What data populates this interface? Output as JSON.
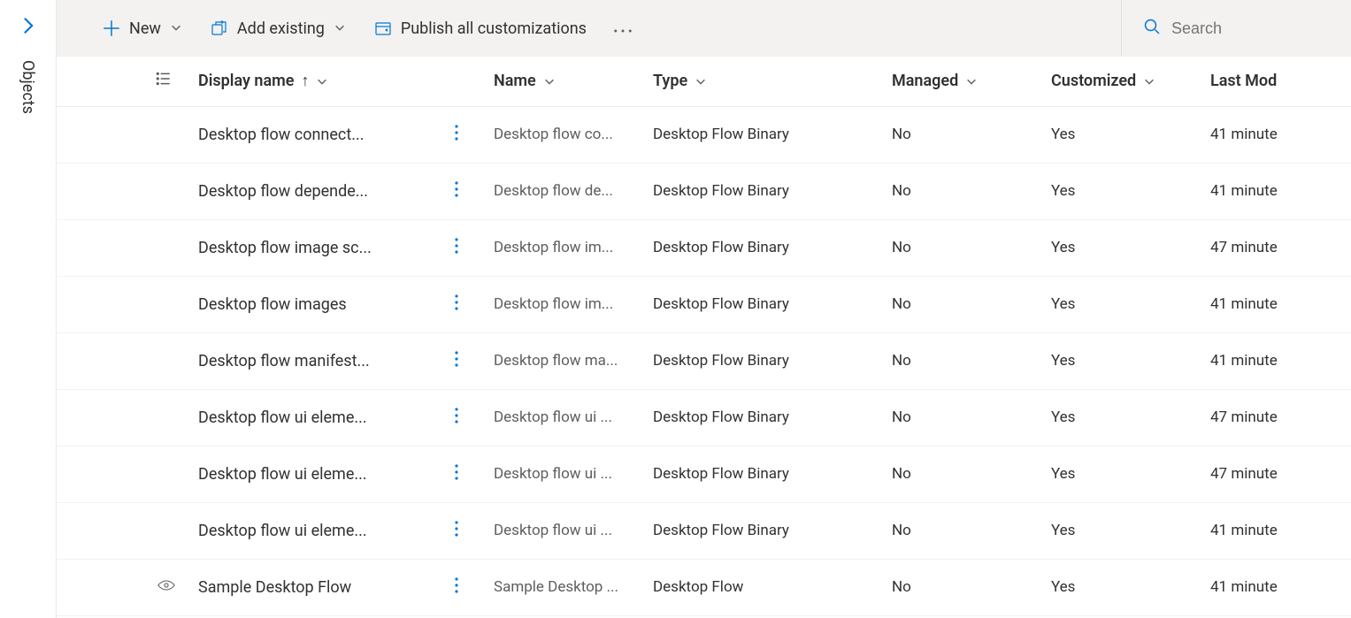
{
  "side": {
    "label": "Objects"
  },
  "commands": {
    "new": "New",
    "add_existing": "Add existing",
    "publish": "Publish all customizations"
  },
  "search": {
    "placeholder": "Search"
  },
  "columns": {
    "display_name": "Display name",
    "name": "Name",
    "type": "Type",
    "managed": "Managed",
    "customized": "Customized",
    "last_modified": "Last Mod"
  },
  "rows": [
    {
      "display": "Desktop flow connect...",
      "name": "Desktop flow co...",
      "type": "Desktop Flow Binary",
      "managed": "No",
      "customized": "Yes",
      "modified": "41 minute",
      "visible_icon": false
    },
    {
      "display": "Desktop flow depende...",
      "name": "Desktop flow de...",
      "type": "Desktop Flow Binary",
      "managed": "No",
      "customized": "Yes",
      "modified": "41 minute",
      "visible_icon": false
    },
    {
      "display": "Desktop flow image sc...",
      "name": "Desktop flow im...",
      "type": "Desktop Flow Binary",
      "managed": "No",
      "customized": "Yes",
      "modified": "47 minute",
      "visible_icon": false
    },
    {
      "display": "Desktop flow images",
      "name": "Desktop flow im...",
      "type": "Desktop Flow Binary",
      "managed": "No",
      "customized": "Yes",
      "modified": "41 minute",
      "visible_icon": false
    },
    {
      "display": "Desktop flow manifest...",
      "name": "Desktop flow ma...",
      "type": "Desktop Flow Binary",
      "managed": "No",
      "customized": "Yes",
      "modified": "41 minute",
      "visible_icon": false
    },
    {
      "display": "Desktop flow ui eleme...",
      "name": "Desktop flow ui ...",
      "type": "Desktop Flow Binary",
      "managed": "No",
      "customized": "Yes",
      "modified": "47 minute",
      "visible_icon": false
    },
    {
      "display": "Desktop flow ui eleme...",
      "name": "Desktop flow ui ...",
      "type": "Desktop Flow Binary",
      "managed": "No",
      "customized": "Yes",
      "modified": "47 minute",
      "visible_icon": false
    },
    {
      "display": "Desktop flow ui eleme...",
      "name": "Desktop flow ui ...",
      "type": "Desktop Flow Binary",
      "managed": "No",
      "customized": "Yes",
      "modified": "41 minute",
      "visible_icon": false
    },
    {
      "display": "Sample Desktop Flow",
      "name": "Sample Desktop ...",
      "type": "Desktop Flow",
      "managed": "No",
      "customized": "Yes",
      "modified": "41 minute",
      "visible_icon": true
    }
  ]
}
